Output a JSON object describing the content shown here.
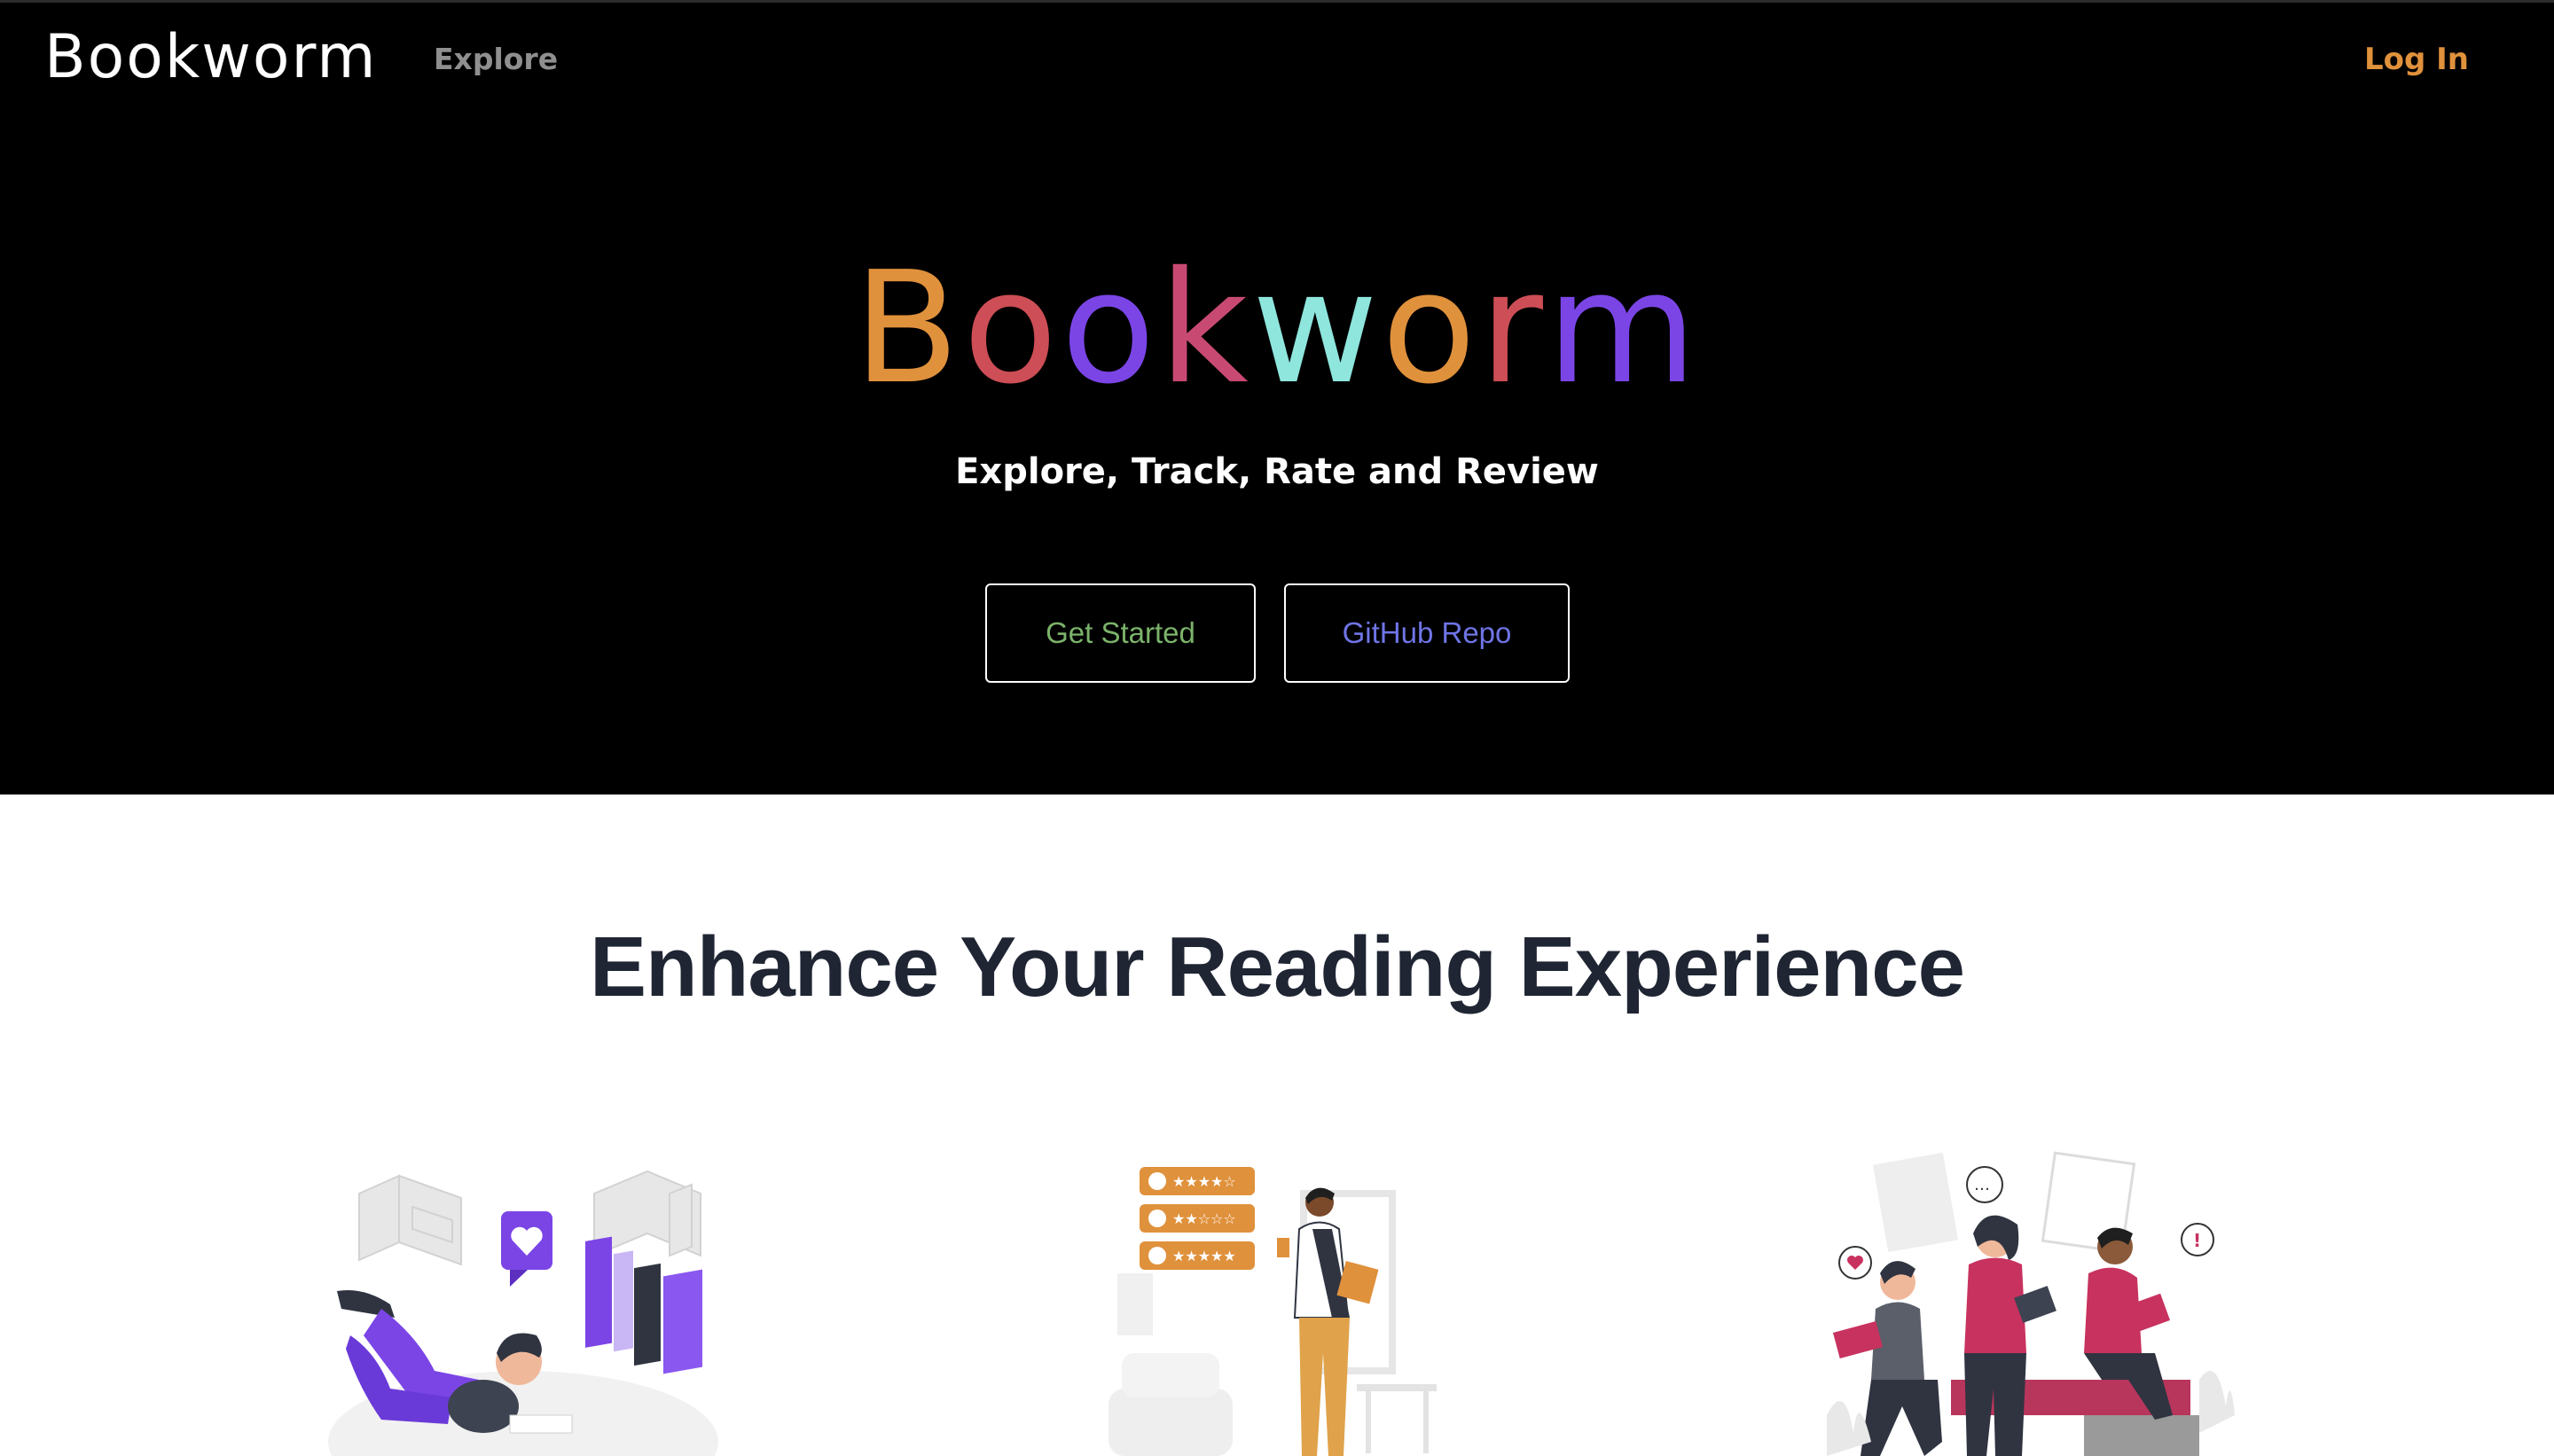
{
  "nav": {
    "brand": "Bookworm",
    "explore": "Explore",
    "login": "Log In"
  },
  "hero": {
    "title_letters": [
      {
        "char": "B",
        "color": "#e0913c"
      },
      {
        "char": "o",
        "color": "#cd4e56"
      },
      {
        "char": "o",
        "color": "#7b45e6"
      },
      {
        "char": "k",
        "color": "#c84a72"
      },
      {
        "char": "w",
        "color": "#8ee6dd"
      },
      {
        "char": "o",
        "color": "#e0913c"
      },
      {
        "char": "r",
        "color": "#cd4e56"
      },
      {
        "char": "m",
        "color": "#7b45e6"
      }
    ],
    "tagline": "Explore, Track, Rate and Review",
    "buttons": {
      "get_started": "Get Started",
      "github_repo": "GitHub Repo"
    }
  },
  "features": {
    "heading": "Enhance Your Reading Experience",
    "illustrations": [
      {
        "icon": "reader-with-books-illustration"
      },
      {
        "icon": "ratings-review-illustration"
      },
      {
        "icon": "reading-group-illustration"
      }
    ]
  },
  "colors": {
    "accent_orange": "#e0913c",
    "accent_purple": "#7b45e6",
    "accent_green": "#7bb36a",
    "accent_blue": "#6f75e6",
    "heading_dark": "#1f2533"
  }
}
